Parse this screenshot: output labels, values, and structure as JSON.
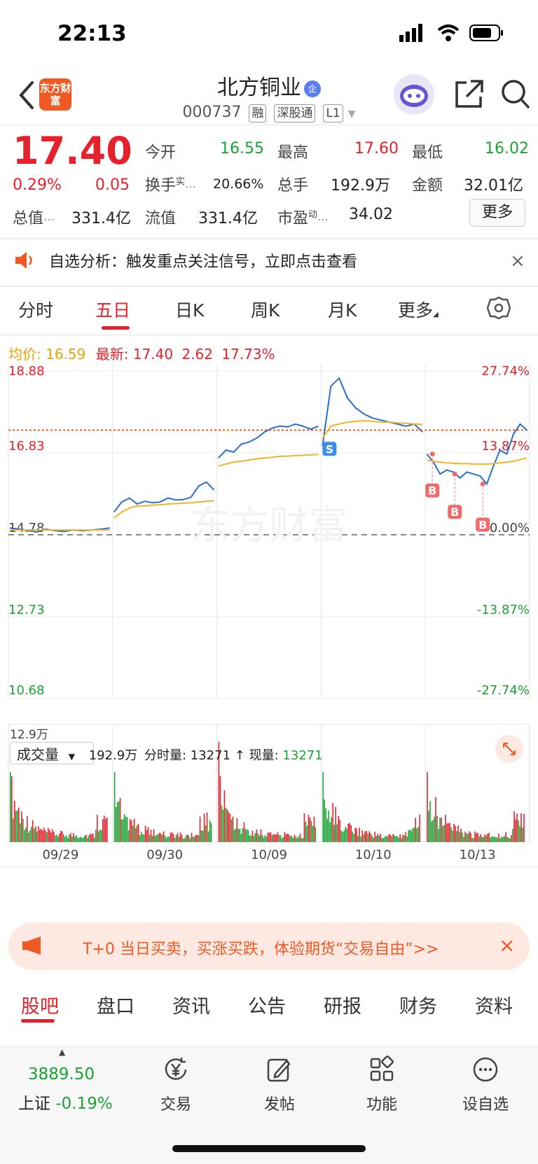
{
  "status": {
    "time": "22:13"
  },
  "header": {
    "title": "北方铜业",
    "cert_badge": "企",
    "logo_text": "东方财富",
    "code": "000737",
    "tags": [
      "融",
      "深股通",
      "L1"
    ]
  },
  "quote": {
    "price": "17.40",
    "change_pct": "0.29%",
    "change": "0.05",
    "open_label": "今开",
    "open": "16.55",
    "high_label": "最高",
    "high": "17.60",
    "low_label": "最低",
    "low": "16.02",
    "turnover_label": "换手",
    "turnover_sup": "实",
    "turnover": "20.66%",
    "volume_label": "总手",
    "volume": "192.9万",
    "amount_label": "金额",
    "amount": "32.01亿",
    "mktcap_label": "总值",
    "mktcap": "331.4亿",
    "float_label": "流值",
    "float": "331.4亿",
    "pe_label": "市盈",
    "pe_sup": "动",
    "pe": "34.02",
    "more": "更多"
  },
  "notice": {
    "text": "自选分析：触发重点关注信号，立即点击查看"
  },
  "kline_tabs": [
    "分时",
    "五日",
    "日K",
    "周K",
    "月K",
    "更多"
  ],
  "kline_active": "五日",
  "chart_header": {
    "avg_label": "均价:",
    "avg": "16.59",
    "latest_label": "最新:",
    "latest": "17.40",
    "chg": "2.62",
    "chg_pct": "17.73%"
  },
  "chart_data": {
    "type": "line",
    "x_labels": [
      "09/29",
      "09/30",
      "10/09",
      "10/10",
      "10/13"
    ],
    "y_left_ticks": [
      "18.88",
      "16.83",
      "14.78",
      "12.73",
      "10.68"
    ],
    "y_right_ticks": [
      "27.74%",
      "13.87%",
      "0.00%",
      "-13.87%",
      "-27.74%"
    ],
    "ylim": [
      10.68,
      18.88
    ],
    "ref_price": 14.78,
    "latest_line": 17.4,
    "series": [
      {
        "name": "price",
        "color": "#2a6fc9",
        "values": [
          14.95,
          14.92,
          14.88,
          14.85,
          14.92,
          14.88,
          14.86,
          14.9,
          14.88,
          14.9,
          14.92,
          14.95,
          15.35,
          15.6,
          15.7,
          15.55,
          15.62,
          15.58,
          15.6,
          15.7,
          15.65,
          15.66,
          15.72,
          16.0,
          16.1,
          15.9,
          16.7,
          16.9,
          16.85,
          17.05,
          17.1,
          17.2,
          17.35,
          17.45,
          17.5,
          17.48,
          17.55,
          17.5,
          17.42,
          17.5,
          17.0,
          18.5,
          18.7,
          18.2,
          17.95,
          17.8,
          17.7,
          17.65,
          17.6,
          17.55,
          17.5,
          17.55,
          17.35,
          16.8,
          16.6,
          16.3,
          16.4,
          16.35,
          16.2,
          16.35,
          16.3,
          16.25,
          16.05,
          16.5,
          16.9,
          16.8,
          17.3,
          17.55,
          17.4
        ]
      },
      {
        "name": "avg",
        "color": "#f0b429",
        "values": [
          14.9,
          14.9,
          14.9,
          14.9,
          14.9,
          14.9,
          14.9,
          14.9,
          14.9,
          14.9,
          14.9,
          14.9,
          15.2,
          15.35,
          15.45,
          15.5,
          15.5,
          15.52,
          15.53,
          15.55,
          15.56,
          15.57,
          15.58,
          15.6,
          15.62,
          15.63,
          16.5,
          16.55,
          16.6,
          16.62,
          16.65,
          16.68,
          16.7,
          16.72,
          16.74,
          16.75,
          16.76,
          16.77,
          16.78,
          16.79,
          17.2,
          17.5,
          17.55,
          17.6,
          17.62,
          17.63,
          17.62,
          17.6,
          17.6,
          17.58,
          17.57,
          17.55,
          17.54,
          16.65,
          16.62,
          16.6,
          16.58,
          16.57,
          16.56,
          16.56,
          16.55,
          16.55,
          16.55,
          16.56,
          16.58,
          16.6,
          16.62,
          16.66,
          16.7
        ]
      }
    ],
    "signals": [
      {
        "label": "S",
        "color": "#3a8ee6"
      },
      {
        "label": "B",
        "color": "#f06a6a"
      },
      {
        "label": "B",
        "color": "#f06a6a"
      },
      {
        "label": "B",
        "color": "#f06a6a"
      }
    ],
    "watermark": "东方财富"
  },
  "volume": {
    "selector": "成交量",
    "total": "192.9万",
    "tick_label": "分时量:",
    "tick": "13271",
    "arrow": "↑",
    "current_label": "现量:",
    "current": "13271",
    "max_label": "12.9万"
  },
  "promo": {
    "text": "T+0 当日买卖，买涨买跌，体验期货“交易自由”>>"
  },
  "bottom_tabs": [
    "股吧",
    "盘口",
    "资讯",
    "公告",
    "研报",
    "财务",
    "资料"
  ],
  "toolbar": {
    "index_value": "3889.50",
    "index_name": "上证",
    "index_change": "-0.19%",
    "trade": "交易",
    "post": "发帖",
    "functions": "功能",
    "watch": "设自选"
  }
}
